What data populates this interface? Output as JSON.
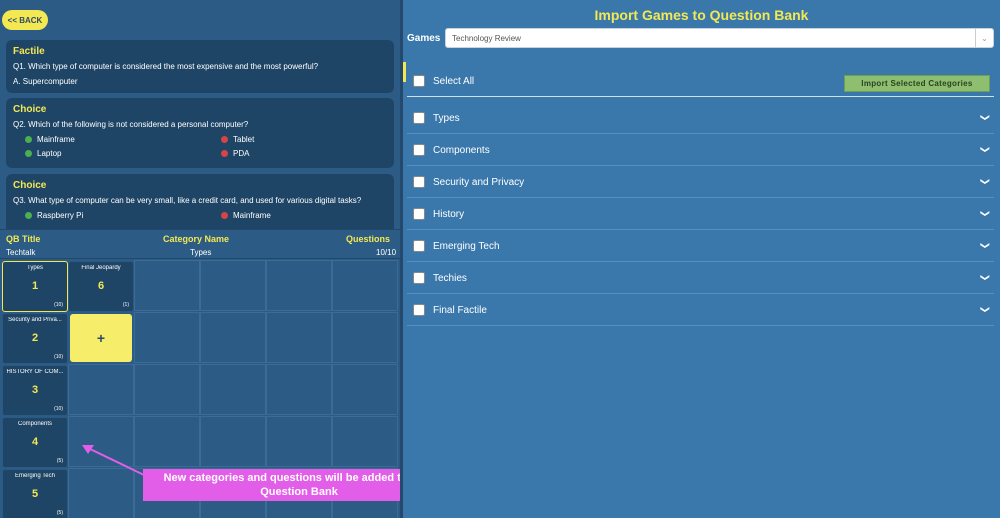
{
  "back_button": {
    "label": "<< BACK"
  },
  "questions": [
    {
      "type": "Factile",
      "text": "Q1. Which type of computer is considered the most expensive and the most powerful?",
      "answer": "A. Supercomputer"
    },
    {
      "type": "Choice",
      "text": "Q2. Which of the following is not considered a personal computer?",
      "options": [
        {
          "label": "Mainframe",
          "status": "correct"
        },
        {
          "label": "Tablet",
          "status": "incorrect"
        },
        {
          "label": "Laptop",
          "status": "correct"
        },
        {
          "label": "PDA",
          "status": "incorrect"
        }
      ]
    },
    {
      "type": "Choice",
      "text": "Q3. What type of computer can be very small, like a credit card, and used for various digital tasks?",
      "options": [
        {
          "label": "Raspberry Pi",
          "status": "correct"
        },
        {
          "label": "Mainframe",
          "status": "incorrect"
        }
      ]
    }
  ],
  "qb_table": {
    "headers": {
      "qb_title": "QB Title",
      "category_name": "Category Name",
      "questions": "Questions"
    },
    "row": {
      "qb_title": "Techtalk",
      "category_name": "Types",
      "questions": "10/10"
    }
  },
  "board": {
    "categories": [
      {
        "name": "Types",
        "number": "1",
        "count": "(10)"
      },
      {
        "name": "Security and Priva...",
        "number": "2",
        "count": "(10)"
      },
      {
        "name": "HISTORY OF COM...",
        "number": "3",
        "count": "(10)"
      },
      {
        "name": "Components",
        "number": "4",
        "count": "(5)"
      },
      {
        "name": "Emerging Tech",
        "number": "5",
        "count": "(5)"
      }
    ],
    "final": {
      "name": "Final Jeopardy",
      "number": "6",
      "count": "(1)"
    },
    "add_label": "+"
  },
  "callout": {
    "line1": "New categories and questions will be added to your",
    "line2": "Question Bank"
  },
  "right": {
    "title": "Import Games to Question Bank",
    "games_label": "Games",
    "games_value": "Technology Review",
    "select_all": "Select All",
    "import_button": "Import Selected Categories",
    "categories": [
      "Types",
      "Components",
      "Security and Privacy",
      "History",
      "Emerging Tech",
      "Techies",
      "Final Factile"
    ]
  },
  "colors": {
    "accent": "#f3e852",
    "left_panel": "#2c5b85",
    "right_panel": "#3a78ac",
    "card": "#1f4566",
    "import_button": "#8ebf70",
    "callout": "#e35ee8",
    "correct": "#4caf50",
    "incorrect": "#d64545"
  },
  "icons": {
    "back": "chevron-left",
    "dropdown": "chevron-down-icon",
    "category_expand": "chevron-down-icon",
    "callout_arrow": "arrow-icon"
  }
}
